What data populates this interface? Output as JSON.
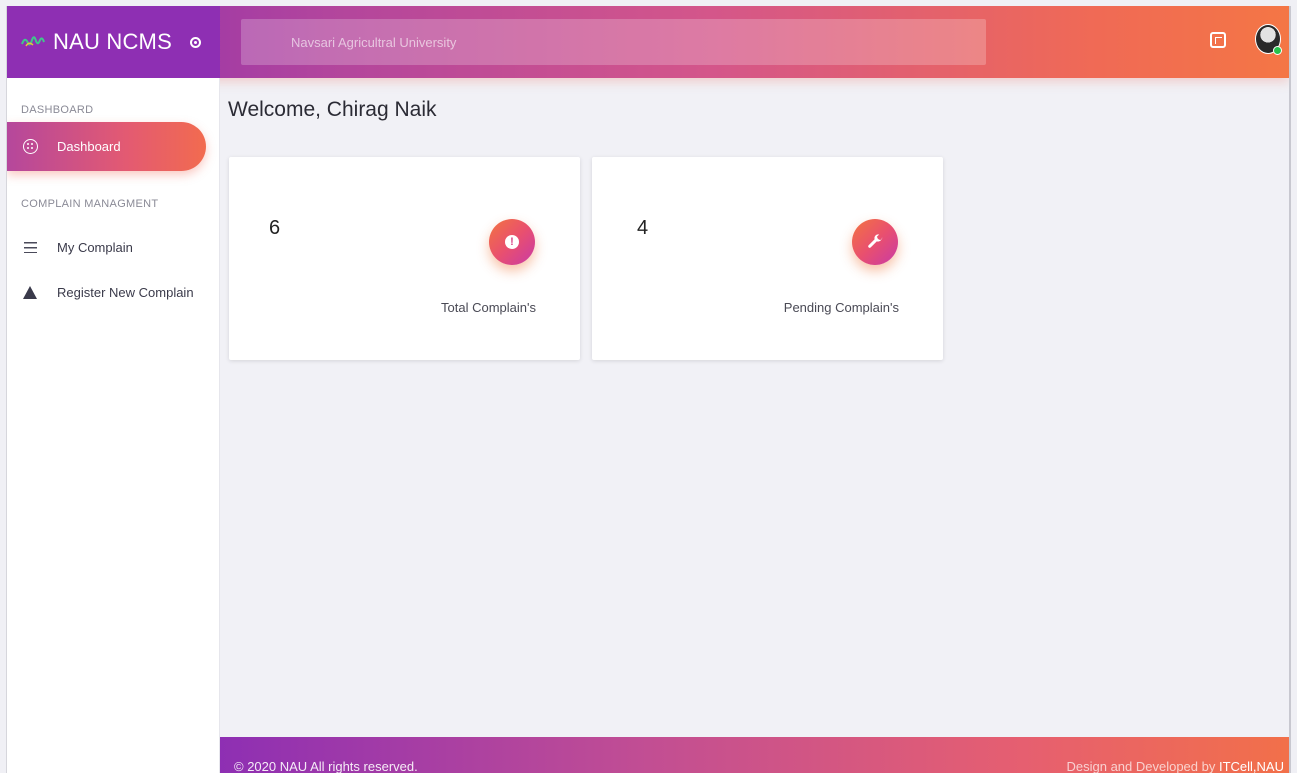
{
  "brand": {
    "name": "NAU NCMS"
  },
  "search": {
    "placeholder": "Navsari Agricultral University"
  },
  "sidebar": {
    "sections": [
      {
        "title": "DASHBOARD"
      },
      {
        "title": "COMPLAIN MANAGMENT"
      }
    ],
    "items": [
      {
        "label": "Dashboard",
        "icon": "dashboard-icon",
        "active": true
      },
      {
        "label": "My Complain",
        "icon": "list-icon",
        "active": false
      },
      {
        "label": "Register New Complain",
        "icon": "warning-icon",
        "active": false
      }
    ]
  },
  "main": {
    "welcome": "Welcome, Chirag Naik",
    "cards": [
      {
        "value": "6",
        "label": "Total Complain's",
        "icon": "exclamation-icon"
      },
      {
        "value": "4",
        "label": "Pending Complain's",
        "icon": "wrench-icon"
      }
    ]
  },
  "footer": {
    "copyright": "© 2020 NAU All rights reserved.",
    "credit_prefix": "Design and Developed by ",
    "credit_link": "ITCell,NAU"
  },
  "colors": {
    "brand": "#8e2fb3",
    "accent_start": "#b5479c",
    "accent_end": "#f26b4f",
    "online": "#27c24c"
  }
}
